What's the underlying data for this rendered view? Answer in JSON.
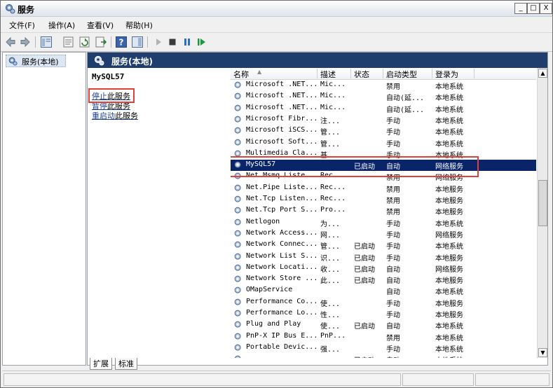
{
  "window": {
    "title": "服务",
    "minimize": "_",
    "maximize": "□",
    "close": "X"
  },
  "menu": [
    {
      "label": "文件(F)"
    },
    {
      "label": "操作(A)"
    },
    {
      "label": "查看(V)"
    },
    {
      "label": "帮助(H)"
    }
  ],
  "tree": {
    "label": "服务(本地)"
  },
  "panel": {
    "header": "服务(本地)",
    "selected_service": "MySQL57",
    "actions": {
      "stop_link": "停止",
      "stop_text": "此服务",
      "pause_link": "暂停",
      "pause_text": "此服务",
      "restart_link": "重启动",
      "restart_text": "此服务"
    }
  },
  "table": {
    "columns": [
      "名称",
      "描述",
      "状态",
      "启动类型",
      "登录为"
    ],
    "rows": [
      {
        "name": "Microsoft .NET...",
        "desc": "Mic...",
        "status": "",
        "startup": "禁用",
        "logon": "本地系统"
      },
      {
        "name": "Microsoft .NET...",
        "desc": "Mic...",
        "status": "",
        "startup": "自动(延...",
        "logon": "本地系统"
      },
      {
        "name": "Microsoft .NET...",
        "desc": "Mic...",
        "status": "",
        "startup": "自动(延...",
        "logon": "本地系统"
      },
      {
        "name": "Microsoft Fibr...",
        "desc": "注...",
        "status": "",
        "startup": "手动",
        "logon": "本地系统"
      },
      {
        "name": "Microsoft iSCS...",
        "desc": "管...",
        "status": "",
        "startup": "手动",
        "logon": "本地系统"
      },
      {
        "name": "Microsoft Soft...",
        "desc": "管...",
        "status": "",
        "startup": "手动",
        "logon": "本地系统"
      },
      {
        "name": "Multimedia Cla...",
        "desc": "基...",
        "status": "",
        "startup": "手动",
        "logon": "本地系统"
      },
      {
        "name": "MySQL57",
        "desc": "",
        "status": "已启动",
        "startup": "自动",
        "logon": "网络服务"
      },
      {
        "name": "Net.Msmq Liste...",
        "desc": "Rec...",
        "status": "",
        "startup": "禁用",
        "logon": "网络服务"
      },
      {
        "name": "Net.Pipe Liste...",
        "desc": "Rec...",
        "status": "",
        "startup": "禁用",
        "logon": "本地服务"
      },
      {
        "name": "Net.Tcp Listen...",
        "desc": "Rec...",
        "status": "",
        "startup": "禁用",
        "logon": "本地服务"
      },
      {
        "name": "Net.Tcp Port S...",
        "desc": "Pro...",
        "status": "",
        "startup": "禁用",
        "logon": "本地服务"
      },
      {
        "name": "Netlogon",
        "desc": "为...",
        "status": "",
        "startup": "手动",
        "logon": "本地系统"
      },
      {
        "name": "Network Access...",
        "desc": "网...",
        "status": "",
        "startup": "手动",
        "logon": "网络服务"
      },
      {
        "name": "Network Connec...",
        "desc": "管...",
        "status": "已启动",
        "startup": "手动",
        "logon": "本地系统"
      },
      {
        "name": "Network List S...",
        "desc": "识...",
        "status": "已启动",
        "startup": "手动",
        "logon": "本地服务"
      },
      {
        "name": "Network Locati...",
        "desc": "收...",
        "status": "已启动",
        "startup": "自动",
        "logon": "网络服务"
      },
      {
        "name": "Network Store ...",
        "desc": "此...",
        "status": "已启动",
        "startup": "自动",
        "logon": "本地服务"
      },
      {
        "name": "OMapService",
        "desc": "",
        "status": "",
        "startup": "自动",
        "logon": "本地系统"
      },
      {
        "name": "Performance Co...",
        "desc": "使...",
        "status": "",
        "startup": "手动",
        "logon": "本地服务"
      },
      {
        "name": "Performance Lo...",
        "desc": "性...",
        "status": "",
        "startup": "手动",
        "logon": "本地服务"
      },
      {
        "name": "Plug and Play",
        "desc": "使...",
        "status": "已启动",
        "startup": "自动",
        "logon": "本地系统"
      },
      {
        "name": "PnP-X IP Bus E...",
        "desc": "PnP...",
        "status": "",
        "startup": "禁用",
        "logon": "本地系统"
      },
      {
        "name": "Portable Devic...",
        "desc": "强...",
        "status": "",
        "startup": "手动",
        "logon": "本地系统"
      },
      {
        "name": "",
        "desc": "",
        "status": "已启动",
        "startup": "自动",
        "logon": "本地系统"
      }
    ],
    "selected_index": 7
  },
  "tabs": [
    {
      "label": "扩展"
    },
    {
      "label": "标准"
    }
  ],
  "colors": {
    "selection": "#0a246a",
    "header": "#1f3e6e",
    "highlight_box": "#e0403a",
    "link": "#1c3f94"
  }
}
